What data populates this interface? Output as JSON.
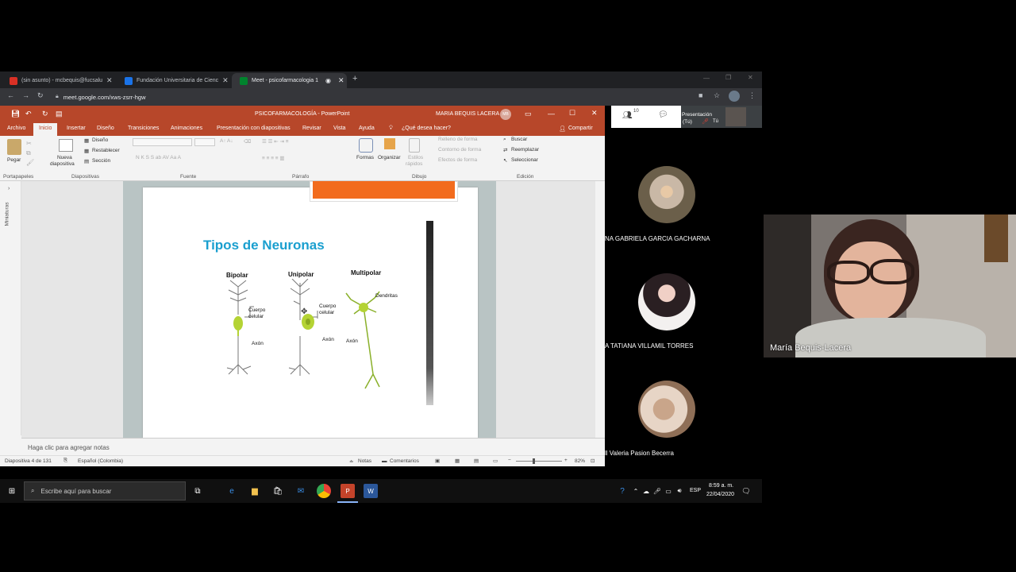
{
  "browser": {
    "tabs": [
      {
        "title": "(sin asunto) - mcbequis@fucsalu",
        "color": "#d93025"
      },
      {
        "title": "Fundación Universitaria de Cienc",
        "color": "#1a73e8"
      },
      {
        "title": "Meet - psicofarmacologia 1",
        "color": "#00832d"
      }
    ],
    "url": "meet.google.com/xws-zsrr-hgw"
  },
  "powerpoint": {
    "title": "PSICOFARMACOLOGÍA  -  PowerPoint",
    "user": "MARIA BEQUIS LACERA",
    "user_initials": "MB",
    "menu": [
      "Archivo",
      "Inicio",
      "Insertar",
      "Diseño",
      "Transiciones",
      "Animaciones",
      "Presentación con diapositivas",
      "Revisar",
      "Vista",
      "Ayuda",
      "¿Qué desea hacer?"
    ],
    "share": "Compartir",
    "ribbon": {
      "pegar": "Pegar",
      "nueva": "Nueva",
      "diapositiva": "diapositiva",
      "diseno": "Diseño",
      "restablecer": "Restablecer",
      "seccion": "Sección",
      "formas": "Formas",
      "organizar": "Organizar",
      "estilos": "Estilos",
      "rapidos": "rápidos",
      "relleno": "Relleno de forma",
      "contorno": "Contorno de forma",
      "efectos": "Efectos de forma",
      "buscar": "Buscar",
      "reemplazar": "Reemplazar",
      "seleccionar": "Seleccionar",
      "groups": [
        "Portapapeles",
        "Diapositivas",
        "Fuente",
        "Párrafo",
        "Dibujo",
        "Edición"
      ]
    },
    "sidebar_label": "Miniaturas",
    "slide": {
      "title": "Tipos de Neuronas",
      "bipolar": "Bipolar",
      "unipolar": "Unipolar",
      "multipolar": "Multipolar",
      "cuerpo": "Cuerpo",
      "celular": "celular",
      "axon": "Axón",
      "dendritas": "Dendritas"
    },
    "notes_placeholder": "Haga clic para agregar notas",
    "status": {
      "slide": "Diapositiva 4 de 131",
      "language": "Español (Colombia)",
      "notes": "Notas",
      "comments": "Comentarios",
      "zoom": "82%"
    }
  },
  "meet": {
    "participants_count": "10",
    "presenting": "Presentación",
    "presenting_sub": "(Tú)",
    "you": "Tú",
    "participants": [
      {
        "name": "NA GABRIELA GARCIA GACHARNA"
      },
      {
        "name": "A TATIANA VILLAMIL TORRES"
      },
      {
        "name": "ll Valeria Pasion Becerra"
      }
    ],
    "speaker": "María Bequis-Lacera"
  },
  "taskbar": {
    "search_placeholder": "Escribe aquí para buscar",
    "lang": "ESP",
    "time": "8:59 a. m.",
    "date": "22/04/2020"
  }
}
